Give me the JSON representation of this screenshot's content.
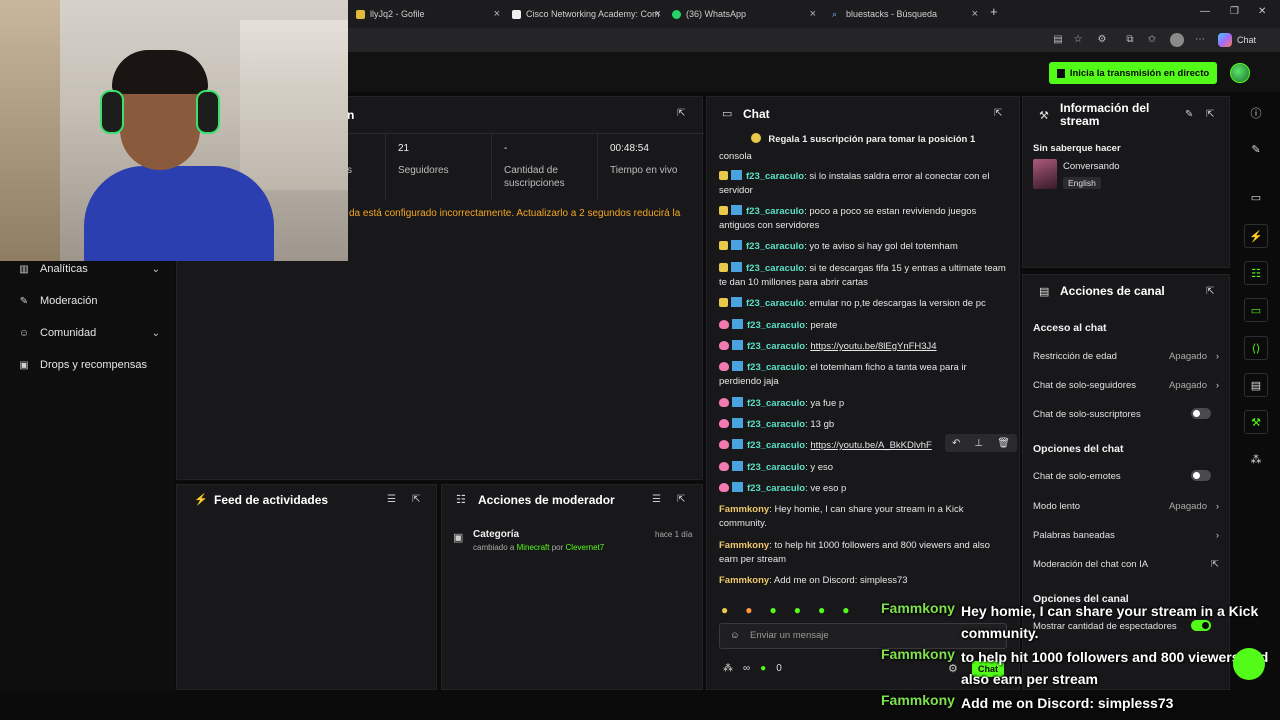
{
  "browser": {
    "tabs": [
      {
        "label": "llyJq2 - Gofile",
        "icon": "lock-icon"
      },
      {
        "label": "Cisco Networking Academy: Com",
        "icon": "page-icon"
      },
      {
        "label": "(36) WhatsApp",
        "icon": "whatsapp-icon"
      },
      {
        "label": "bluestacks - Búsqueda",
        "icon": "search-icon"
      }
    ],
    "new_tab": "+",
    "chat_button": "Chat"
  },
  "header": {
    "go_live": "Inicia la transmisión en directo"
  },
  "sidebar": {
    "items": [
      {
        "label": "Analíticas",
        "icon": "chart-icon",
        "chevron": true
      },
      {
        "label": "Moderación",
        "icon": "shield-icon",
        "chevron": false
      },
      {
        "label": "Comunidad",
        "icon": "users-icon",
        "chevron": true
      },
      {
        "label": "Drops y recompensas",
        "icon": "gift-icon",
        "chevron": false
      }
    ]
  },
  "stats": {
    "title_fragment": "n",
    "label_fragment": "s",
    "followers_value": "21",
    "followers_label": "Seguidores",
    "subs_value": "-",
    "subs_label": "Cantidad de suscripciones",
    "uptime_value": "00:48:54",
    "uptime_label": "Tiempo en vivo",
    "warning": "da está configurado incorrectamente. Actualizarlo a 2 segundos reducirá la"
  },
  "activity_feed": {
    "title": "Feed de actividades"
  },
  "mod_actions": {
    "title": "Acciones de moderador",
    "entry_title": "Categoría",
    "entry_time": "hace 1 día",
    "entry_prefix": "cambiado a",
    "entry_category": "Minecraft",
    "entry_by": "por",
    "entry_user": "Clevernet7"
  },
  "chat": {
    "title": "Chat",
    "pinned": "Regala 1 suscripción para tomar la posición 1",
    "partial_top": "consola",
    "messages": [
      {
        "badge": "y",
        "user": "f23_caraculo",
        "text": "si lo instalas saldra error al conectar con el servidor"
      },
      {
        "badge": "y",
        "user": "f23_caraculo",
        "text": "poco a poco se estan reviviendo juegos antiguos con servidores"
      },
      {
        "badge": "y",
        "user": "f23_caraculo",
        "text": "yo te aviso si hay gol del totemham"
      },
      {
        "badge": "y",
        "user": "f23_caraculo",
        "text": "si te descargas fifa 15 y entras a ultimate team te dan 10 millones para abrir cartas"
      },
      {
        "badge": "y",
        "user": "f23_caraculo",
        "text": "emular no p,te descargas la version de pc"
      },
      {
        "badge": "p",
        "user": "f23_caraculo",
        "text": "perate"
      },
      {
        "badge": "p",
        "user": "f23_caraculo",
        "text": "https://youtu.be/8lEgYnFH3J4",
        "link": true
      },
      {
        "badge": "p",
        "user": "f23_caraculo",
        "text": "el totemham ficho a tanta wea para ir perdiendo jaja"
      },
      {
        "badge": "p",
        "user": "f23_caraculo",
        "text": "ya fue p"
      },
      {
        "badge": "p",
        "user": "f23_caraculo",
        "text": "13 gb"
      },
      {
        "badge": "p",
        "user": "f23_caraculo",
        "text": "https://youtu.be/A_BkKDlvhF",
        "link": true
      },
      {
        "badge": "p",
        "user": "f23_caraculo",
        "text": "y eso"
      },
      {
        "badge": "p",
        "user": "f23_caraculo",
        "text": "ve eso p"
      },
      {
        "badge": "",
        "user": "Fammkony",
        "text": "Hey homie, I can share your stream in a Kick community."
      },
      {
        "badge": "",
        "user": "Fammkony",
        "text": "to help hit 1000 followers and 800 viewers and also earn per stream"
      },
      {
        "badge": "",
        "user": "Fammkony",
        "text": "Add me on Discord: simpless73"
      }
    ],
    "input_placeholder": "Enviar un mensaje",
    "bottom_count_a": "∞",
    "bottom_count_b": "0",
    "send_label": "Chat"
  },
  "stream_info": {
    "title": "Información del stream",
    "stream_title": "Sin saberque hacer",
    "category": "Conversando",
    "language": "English"
  },
  "channel_actions": {
    "title": "Acciones de canal",
    "section_chat_access": "Acceso al chat",
    "age_restriction": "Restricción de edad",
    "age_value": "Apagado",
    "followers_only": "Chat de solo-seguidores",
    "followers_value": "Apagado",
    "subs_only": "Chat de solo-suscriptores",
    "section_chat_options": "Opciones del chat",
    "emotes_only": "Chat de solo-emotes",
    "slow_mode": "Modo lento",
    "slow_value": "Apagado",
    "banned_words": "Palabras baneadas",
    "ai_moderation": "Moderación del chat con IA",
    "section_channel_options": "Opciones del canal",
    "show_viewers": "Mostrar cantidad de espectadores"
  },
  "overlay": [
    {
      "user": "Fammkony",
      "text": "Hey homie, I can share your stream in a Kick community."
    },
    {
      "user": "Fammkony",
      "text": "to help hit 1000 followers and 800 viewers and also earn per stream"
    },
    {
      "user": "Fammkony",
      "text": "Add me on Discord: simpless73"
    }
  ],
  "colors": {
    "accent": "#53fc18",
    "warning": "#f5a623",
    "username": "#5be1c8"
  }
}
